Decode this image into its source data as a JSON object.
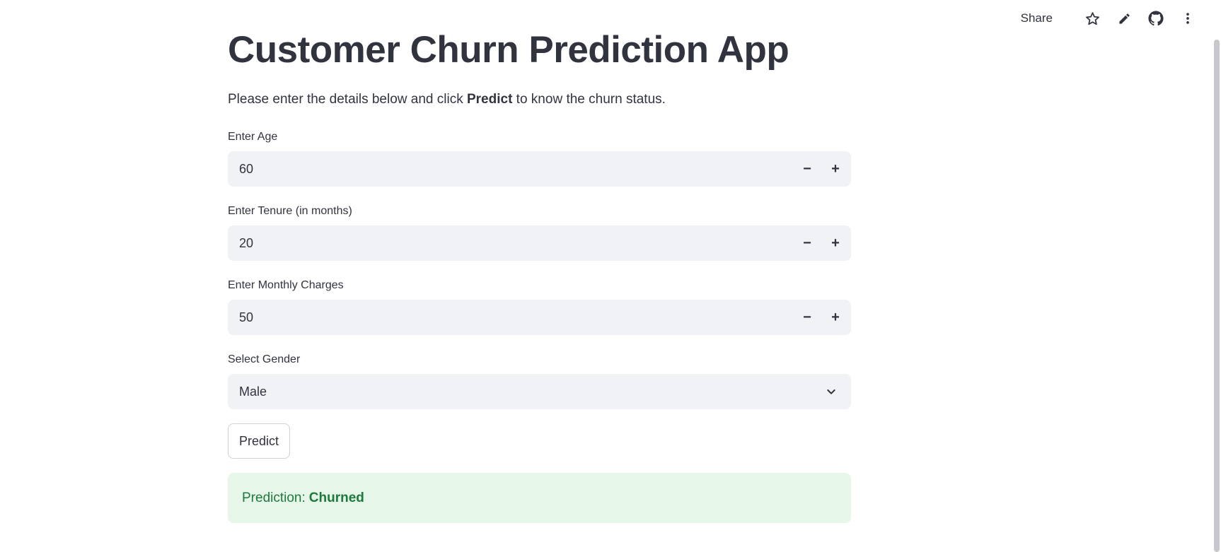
{
  "toolbar": {
    "share_label": "Share",
    "icons": [
      "star-icon",
      "pencil-icon",
      "github-icon",
      "more-vertical-icon"
    ]
  },
  "main": {
    "title": "Customer Churn Prediction App",
    "intro_prefix": "Please enter the details below and click ",
    "intro_bold": "Predict",
    "intro_suffix": " to know the churn status."
  },
  "form": {
    "age": {
      "label": "Enter Age",
      "value": "60"
    },
    "tenure": {
      "label": "Enter Tenure (in months)",
      "value": "20"
    },
    "monthly_charges": {
      "label": "Enter Monthly Charges",
      "value": "50"
    },
    "gender": {
      "label": "Select Gender",
      "selected": "Male"
    },
    "stepper_minus": "−",
    "stepper_plus": "+"
  },
  "predict_button": {
    "label": "Predict"
  },
  "result": {
    "prefix": "Prediction:",
    "value": "Churned"
  },
  "colors": {
    "text": "#31333f",
    "input_bg": "#f0f2f6",
    "success_bg": "#e6f7ea",
    "success_text": "#1e7a3c"
  }
}
